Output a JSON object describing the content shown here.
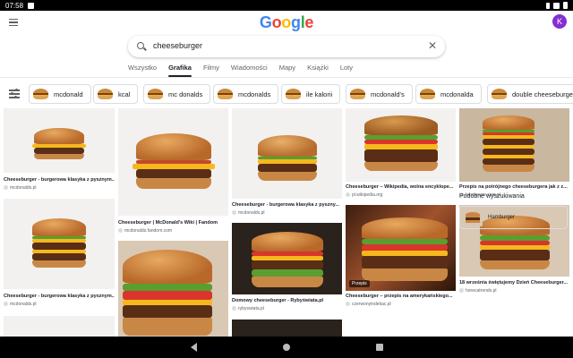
{
  "status_bar": {
    "time": "07:58"
  },
  "header": {
    "logo_letters": [
      {
        "ch": "G",
        "color": "#4285f4"
      },
      {
        "ch": "o",
        "color": "#ea4335"
      },
      {
        "ch": "o",
        "color": "#fbbc05"
      },
      {
        "ch": "g",
        "color": "#4285f4"
      },
      {
        "ch": "l",
        "color": "#34a853"
      },
      {
        "ch": "e",
        "color": "#ea4335"
      }
    ],
    "avatar_letter": "K",
    "avatar_color": "#8430ce"
  },
  "search": {
    "query": "cheeseburger"
  },
  "tabs": [
    "Wszystko",
    "Grafika",
    "Filmy",
    "Wiadomości",
    "Mapy",
    "Książki",
    "Loty"
  ],
  "active_tab": "Grafika",
  "filter_chips": [
    "mcdonald",
    "kcal",
    "mc donalds",
    "mcdonalds",
    "ile kalorii",
    "mcdonald's",
    "mcdonalda",
    "double cheeseburger"
  ],
  "results": {
    "col1": [
      {
        "caption": "Cheeseburger - burgerowa klasyka z pysznym...",
        "source": "mcdonalds.pl"
      },
      {
        "caption": "Cheeseburger - burgerowa klasyka z pysznym...",
        "source": "mcdonalds.pl"
      }
    ],
    "col2": [
      {
        "caption": "Cheeseburger | McDonald's Wiki | Fandom",
        "source": "mcdonalds.fandom.com"
      }
    ],
    "col3": [
      {
        "caption": "Cheeseburger - burgerowa klasyka z pyszny...",
        "source": "mcdonalds.pl"
      },
      {
        "caption": "Domowy cheeseburger - Rybyświata.pl",
        "source": "rybyswiata.pl"
      }
    ],
    "col4": [
      {
        "caption": "Cheeseburger – Wikipedia, wolna encyklope...",
        "source": "pl.wikipedia.org"
      },
      {
        "caption": "Cheeseburger – przepis na amerykańskiego...",
        "source": "czerwonyindekac.pl",
        "badge": "Przepis"
      }
    ],
    "col5": [
      {
        "caption": "Przepis na potrójnego cheeseburgera jak z z...",
        "source": "bezcenzor.com.pl"
      },
      {
        "caption": "18 września świętujemy Dzień Cheeseburger...",
        "source": "horecatrends.pl"
      }
    ]
  },
  "similar": {
    "title": "Podobne wyszukiwania",
    "items": [
      "Hamburger"
    ]
  }
}
